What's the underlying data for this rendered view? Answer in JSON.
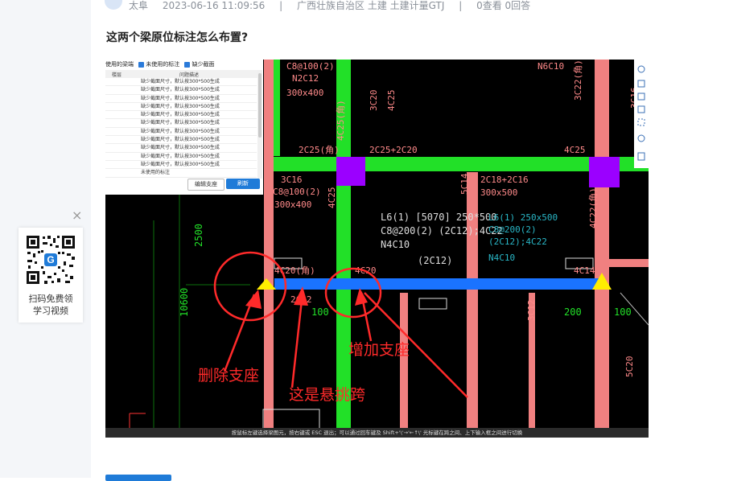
{
  "header": {
    "author": "太阜",
    "datetime": "2023-06-16 11:09:56",
    "sep1": "|",
    "location_category": "广西壮族自治区  土建 土建计量GTJ",
    "sep2": "|",
    "stats": "0查看  0回答"
  },
  "question": {
    "title": "这两个梁原位标注怎么布置?"
  },
  "qr_card": {
    "close_symbol": "×",
    "line1": "扫码免费领",
    "line2": "学习视频",
    "logo_letter": "G"
  },
  "cad_panel": {
    "filters": [
      "使用的梁端",
      "未使用的标注",
      "缺少截面"
    ],
    "col_level": "楼层",
    "col_desc": "问题描述",
    "rows": [
      "缺少截面尺寸，默认按300*500生成",
      "缺少截面尺寸，默认按300*500生成",
      "缺少截面尺寸，默认按300*500生成",
      "缺少截面尺寸，默认按300*500生成",
      "缺少截面尺寸，默认按300*500生成",
      "缺少截面尺寸，默认按300*500生成",
      "缺少截面尺寸，默认按300*500生成",
      "缺少截面尺寸，默认按300*500生成",
      "缺少截面尺寸，默认按300*500生成",
      "缺少截面尺寸，默认按300*500生成",
      "缺少截面尺寸，默认按300*500生成",
      "未使用的标注"
    ],
    "btn_edit": "编辑支座",
    "btn_refresh": "刷新"
  },
  "cad_labels": {
    "top1": "C8@100(2)",
    "top2": "N2C12",
    "top3": "300x400",
    "top4": "4C25(角)",
    "top5": "3C20",
    "top6": "4C25",
    "top7": "N6C10",
    "top8": "3C22(角)",
    "top9": "3C16",
    "beam_a": "2C25(角)",
    "beam_b": "2C25+2C20",
    "beam_c": "4C25",
    "col1": "3C16",
    "col2": "C8@100(2)",
    "col3": "300x400",
    "col4": "4C25",
    "col5": "5C14",
    "col6": "2C18+2C16",
    "col7": "300x500",
    "col8": "4C22(角)",
    "dim1": "2500",
    "dim2": "10600",
    "l6_line1": "L6(1) [5070] 250*500",
    "l6_line2": "C8@200(2) (2C12);4C22",
    "l6_line3": "N4C10",
    "l6_line4": "(2C12)",
    "l6b_line1": "L6(1) 250x500",
    "l6b_line2": "C8@200(2)",
    "l6b_line3": "(2C12);4C22",
    "l6b_line4": "N4C10",
    "sup1": "4C20(角)",
    "sup2": "4C20",
    "sup3": "4C14",
    "b_dim1": "100",
    "b_dim2": "200",
    "b_dim3": "100",
    "b_dim4": "2C12",
    "b_dim5": "3C12",
    "b_dim6": "5C20",
    "ann_delete": "删除支座",
    "ann_cantilever": "这是悬挑跨",
    "ann_add": "增加支座"
  },
  "cad_status": "按鼠标左键选择梁图元，按右键或 ESC 退出；可以通过回车键及 Shift+'\\'→'←↑\\' 光标键在跨之间、上下输入框之间进行切换",
  "colors": {
    "green": "#22e028",
    "salmon": "#f08080",
    "blue": "#1a73ff",
    "purple": "#9b00ff",
    "yellow": "#ffee00",
    "red": "#ff2a2a"
  }
}
